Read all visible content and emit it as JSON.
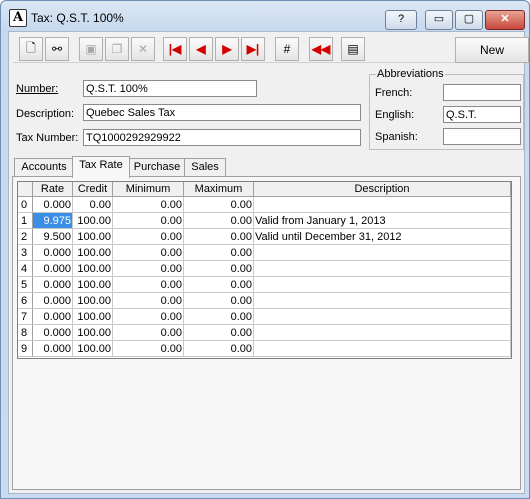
{
  "window": {
    "title": "Tax: Q.S.T. 100%",
    "app_icon": "A"
  },
  "caption": {
    "help": "?",
    "minimize": "▭",
    "maximize": "▢",
    "close": "✕"
  },
  "toolbar": {
    "icons": [
      "new-document-icon",
      "find-binoculars-icon",
      "save-icon",
      "copy-icon",
      "delete-x-icon",
      "first-record-icon",
      "previous-record-icon",
      "next-record-icon",
      "last-record-icon",
      "goto-record-icon",
      "rewind-icon",
      "properties-icon"
    ],
    "new_label": "New"
  },
  "form": {
    "number_label": "Number:",
    "number_value": "Q.S.T. 100%",
    "description_label": "Description:",
    "description_value": "Quebec Sales Tax",
    "tax_number_label": "Tax Number:",
    "tax_number_value": "TQ1000292929922"
  },
  "abbreviations": {
    "title": "Abbreviations",
    "french_label": "French:",
    "french_value": "",
    "english_label": "English:",
    "english_value": "Q.S.T.",
    "spanish_label": "Spanish:",
    "spanish_value": ""
  },
  "tabs": [
    "Accounts",
    "Tax Rate",
    "Purchase",
    "Sales"
  ],
  "active_tab": "Tax Rate",
  "grid": {
    "columns": [
      "Rate",
      "Credit",
      "Minimum",
      "Maximum",
      "Description"
    ],
    "rows": [
      {
        "n": "0",
        "rate": "0.000",
        "credit": "0.00",
        "minimum": "0.00",
        "maximum": "0.00",
        "description": ""
      },
      {
        "n": "1",
        "rate": "9.975",
        "credit": "100.00",
        "minimum": "0.00",
        "maximum": "0.00",
        "description": "Valid from January 1, 2013"
      },
      {
        "n": "2",
        "rate": "9.500",
        "credit": "100.00",
        "minimum": "0.00",
        "maximum": "0.00",
        "description": "Valid until December 31, 2012"
      },
      {
        "n": "3",
        "rate": "0.000",
        "credit": "100.00",
        "minimum": "0.00",
        "maximum": "0.00",
        "description": ""
      },
      {
        "n": "4",
        "rate": "0.000",
        "credit": "100.00",
        "minimum": "0.00",
        "maximum": "0.00",
        "description": ""
      },
      {
        "n": "5",
        "rate": "0.000",
        "credit": "100.00",
        "minimum": "0.00",
        "maximum": "0.00",
        "description": ""
      },
      {
        "n": "6",
        "rate": "0.000",
        "credit": "100.00",
        "minimum": "0.00",
        "maximum": "0.00",
        "description": ""
      },
      {
        "n": "7",
        "rate": "0.000",
        "credit": "100.00",
        "minimum": "0.00",
        "maximum": "0.00",
        "description": ""
      },
      {
        "n": "8",
        "rate": "0.000",
        "credit": "100.00",
        "minimum": "0.00",
        "maximum": "0.00",
        "description": ""
      },
      {
        "n": "9",
        "rate": "0.000",
        "credit": "100.00",
        "minimum": "0.00",
        "maximum": "0.00",
        "description": ""
      }
    ],
    "selected_row": 1,
    "selected_column": "rate",
    "selection_color": "#3a8ee6"
  }
}
